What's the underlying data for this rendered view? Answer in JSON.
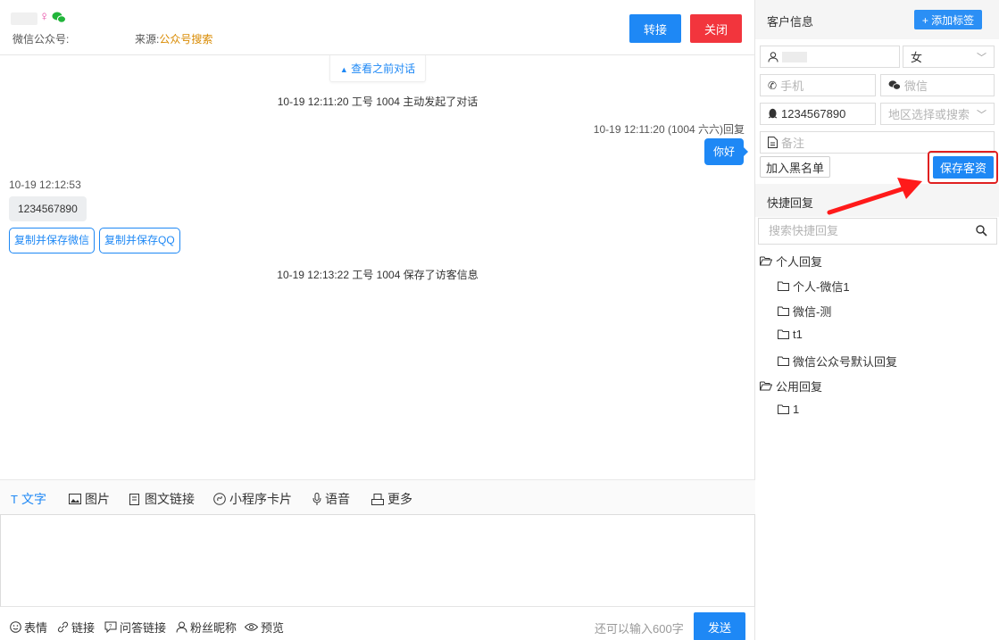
{
  "header": {
    "gender_symbol": "♀",
    "account_label": "微信公众号:",
    "source_label": "来源:",
    "source_value": "公众号搜索",
    "transfer_button": "转接",
    "close_button": "关闭"
  },
  "chat": {
    "view_previous": "查看之前对话",
    "messages": [
      {
        "kind": "system",
        "text": "10-19 12:11:20 工号 1004 主动发起了对话"
      },
      {
        "kind": "agent_meta",
        "text": "10-19 12:11:20 (1004 六六)回复"
      },
      {
        "kind": "agent",
        "text": "你好"
      },
      {
        "kind": "visitor_meta",
        "text": "10-19 12:12:53"
      },
      {
        "kind": "visitor",
        "text": "1234567890"
      },
      {
        "kind": "system",
        "text": "10-19 12:13:22 工号 1004 保存了访客信息"
      }
    ],
    "chips": [
      "复制并保存微信",
      "复制并保存QQ"
    ]
  },
  "toolbar": {
    "items": [
      "文字",
      "图片",
      "图文链接",
      "小程序卡片",
      "语音",
      "更多"
    ]
  },
  "footer": {
    "items": [
      "表情",
      "链接",
      "问答链接",
      "粉丝昵称",
      "预览"
    ],
    "remaining": "还可以输入600字",
    "send": "发送"
  },
  "customer": {
    "title": "客户信息",
    "add_tag": "+ 添加标签",
    "gender_value": "女",
    "phone_placeholder": "手机",
    "wechat_placeholder": "微信",
    "qq_value": "1234567890",
    "region_placeholder": "地区选择或搜索",
    "note_placeholder": "备注",
    "blacklist_button": "加入黑名单",
    "save_button": "保存客资"
  },
  "quick_reply": {
    "title": "快捷回复",
    "search_placeholder": "搜索快捷回复",
    "groups": [
      {
        "label": "个人回复",
        "children": [
          "个人-微信1",
          "微信-测",
          "t1",
          "微信公众号默认回复"
        ]
      },
      {
        "label": "公用回复",
        "children": [
          "1"
        ]
      }
    ]
  },
  "colors": {
    "primary": "#1e88f5",
    "danger": "#f2353d",
    "highlight_border": "#e02020",
    "source_text": "#d98a00"
  }
}
